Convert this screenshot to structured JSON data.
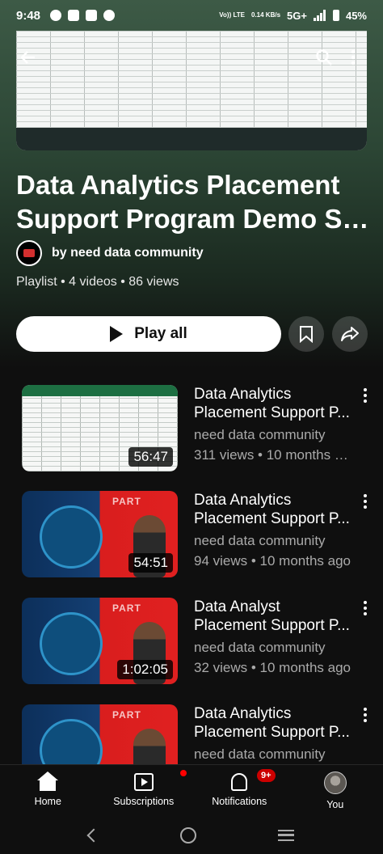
{
  "status_bar": {
    "time": "9:48",
    "network_label": "Vo)) LTE",
    "speed": "0.14 KB/s",
    "signal": "5G+",
    "battery": "45%"
  },
  "playlist": {
    "title_line1": "Data Analytics Placement",
    "title_line2": "Support Program Demo Ses...",
    "owner": "by need data community",
    "meta": "Playlist • 4 videos • 86 views",
    "play_all_label": "Play all"
  },
  "videos": [
    {
      "title_line1": "Data Analytics",
      "title_line2": "Placement Support P...",
      "channel": "need data community",
      "stats": "311 views • 10 months a...",
      "duration": "56:47",
      "thumb_icon": "spreadsheet-thumbnail"
    },
    {
      "title_line1": "Data Analytics",
      "title_line2": "Placement Support P...",
      "channel": "need data community",
      "stats": "94 views • 10 months ago",
      "duration": "54:51",
      "thumb_icon": "promo-thumbnail"
    },
    {
      "title_line1": "Data Analyst",
      "title_line2": "Placement Support P...",
      "channel": "need data community",
      "stats": "32 views • 10 months ago",
      "duration": "1:02:05",
      "thumb_icon": "promo-thumbnail"
    },
    {
      "title_line1": "Data Analytics",
      "title_line2": "Placement Support P...",
      "channel": "need data community",
      "stats": "",
      "duration": "",
      "thumb_icon": "promo-thumbnail"
    }
  ],
  "bottom_nav": {
    "home": "Home",
    "subscriptions": "Subscriptions",
    "notifications": "Notifications",
    "notifications_badge": "9+",
    "you": "You"
  },
  "colors": {
    "background": "#0f0f0f",
    "hero_gradient": "#3d5a46",
    "badge": "#cc0000",
    "secondary_text": "#aaaaaa"
  }
}
